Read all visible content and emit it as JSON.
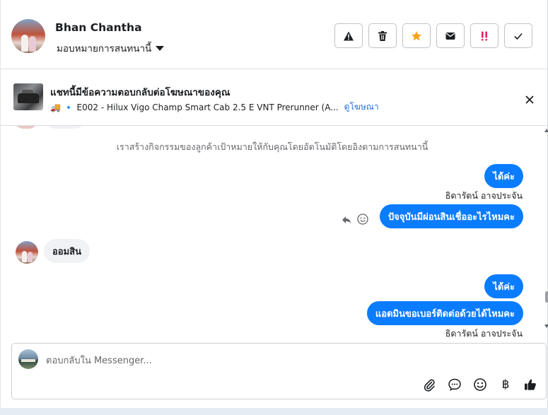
{
  "header": {
    "name": "Bhan Chantha",
    "assign_label": "มอบหมายการสนทนานี้",
    "actions": [
      {
        "id": "report",
        "icon": "warning-icon"
      },
      {
        "id": "delete",
        "icon": "trash-icon"
      },
      {
        "id": "follow-up",
        "icon": "star-icon",
        "color": "#f7a21b"
      },
      {
        "id": "mark-unread",
        "icon": "envelope-icon"
      },
      {
        "id": "spam",
        "icon": "double-exclamation-icon",
        "color": "#e0245e"
      },
      {
        "id": "done",
        "icon": "checkmark-icon"
      }
    ]
  },
  "ad": {
    "title": "แชทนี้มีข้อความตอบกลับต่อโฆษณาของคุณ",
    "description": "🚚 🔹 E002 - Hilux Vigo Champ Smart Cab 2.5 E VNT Prerunner (A...",
    "link": "ดูโฆษณา"
  },
  "chat": {
    "system_note": "เราสร้างกิจกรรมของลูกค้าเป้าหมายให้กับคุณโดยอัตโนมัติโดยอิงตามการสนทนานี้",
    "messages": [
      {
        "direction": "out",
        "text": "ได้ค่ะ"
      },
      {
        "direction": "out-sender",
        "text": "ธิดารัตน์ อาจประจัน"
      },
      {
        "direction": "out",
        "text": "ปัจจุบันมีผ่อนสินเชื่ออะไรไหมคะ"
      },
      {
        "direction": "in",
        "text": "ออมสิน"
      },
      {
        "direction": "out",
        "text": "ได้ค่ะ"
      },
      {
        "direction": "out",
        "text": "แอดมินขอเบอร์ติดต่อด้วยได้ไหมคะ"
      },
      {
        "direction": "out-sender",
        "text": "ธิดารัตน์ อาจประจัน"
      }
    ]
  },
  "composer": {
    "placeholder": "ตอบกลับใน Messenger...",
    "tools": [
      "paperclip-icon",
      "chat-bubble-icon",
      "emoji-icon",
      "baht-icon",
      "thumbs-up-icon"
    ],
    "baht_symbol": "฿"
  },
  "colors": {
    "accent": "#0a7cff",
    "link": "#216fdb",
    "star": "#f7a21b",
    "spam": "#e0245e"
  }
}
